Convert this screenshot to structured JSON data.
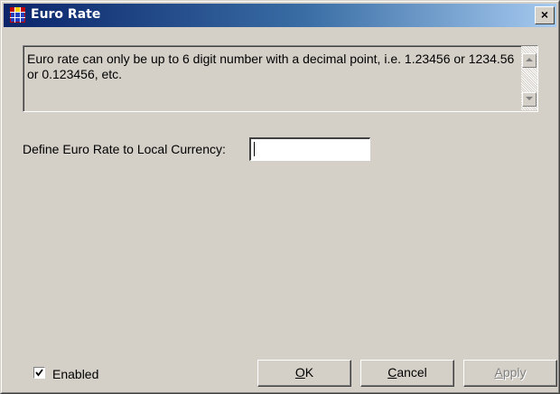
{
  "window": {
    "title": "Euro Rate",
    "close_glyph": "×",
    "icon": "grid-app-icon"
  },
  "info": {
    "text": "Euro rate can only be up to 6 digit number with a decimal point, i.e. 1.23456 or 1234.56 or 0.123456, etc."
  },
  "form": {
    "rate_label": "Define Euro Rate to Local Currency:",
    "rate_value": ""
  },
  "footer": {
    "enabled_label": "Enabled",
    "enabled_checked": true,
    "ok_mnemonic": "O",
    "ok_rest": "K",
    "cancel_mnemonic": "C",
    "cancel_rest": "ancel",
    "apply_mnemonic": "A",
    "apply_rest": "pply",
    "apply_disabled": true
  },
  "colors": {
    "face": "#d4d0c8",
    "title_start": "#0a246a",
    "title_end": "#a6caf0"
  }
}
